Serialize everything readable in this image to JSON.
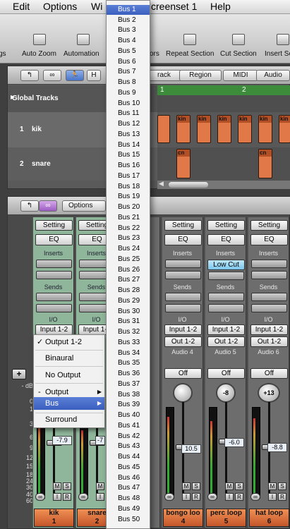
{
  "menubar": {
    "items": [
      "Edit",
      "Options",
      "Wi",
      "creenset 1",
      "Help"
    ]
  },
  "toolbar": {
    "buttons": [
      {
        "label": "gs",
        "icon": "partial-icon"
      },
      {
        "label": "Auto Zoom",
        "icon": "magnifier-icon"
      },
      {
        "label": "Automation",
        "icon": "automation-icon"
      },
      {
        "label": "ors",
        "icon": "partial-icon"
      },
      {
        "label": "Repeat Section",
        "icon": "repeat-icon"
      },
      {
        "label": "Cut Section",
        "icon": "scissors-icon"
      },
      {
        "label": "Insert Se",
        "icon": "insert-icon"
      }
    ]
  },
  "arrange": {
    "header_buttons": {
      "back": "↰",
      "link": "∞",
      "catch": "🏃",
      "h": "H"
    },
    "menus": [
      "rack",
      "Region",
      "MIDI",
      "Audio"
    ],
    "ruler": [
      "1",
      "2"
    ],
    "global_tracks": "Global Tracks",
    "tracks": [
      {
        "num": "1",
        "name": "kik",
        "region_label": "kin"
      },
      {
        "num": "2",
        "name": "snare",
        "region_label": "cn"
      }
    ]
  },
  "mixer": {
    "header": {
      "back": "↰",
      "link": "∞",
      "options": "Options"
    },
    "db_label": "- dB",
    "scale": [
      "0",
      "1",
      "3",
      "6",
      "9",
      "12",
      "15",
      "18",
      "24",
      "30",
      "40",
      "60"
    ],
    "strips": [
      {
        "setting": "Setting",
        "eq": "EQ",
        "inserts": "Inserts",
        "sends": "Sends",
        "io": "I/O",
        "input": "Input 1-2",
        "output": "",
        "audio": "",
        "off": "",
        "pan": "",
        "vol": "-7.9",
        "name": "kik",
        "num": "1",
        "selected": true,
        "m": "M",
        "s": "S",
        "i": "I",
        "r": "R"
      },
      {
        "setting": "Setting",
        "eq": "EQ",
        "inserts": "Inserts",
        "sends": "Sends",
        "io": "I/O",
        "input": "Input 1-2",
        "output": "",
        "audio": "",
        "off": "",
        "pan": "",
        "vol": "-7",
        "name": "snare",
        "num": "2",
        "selected": true,
        "m": "M",
        "s": "S",
        "i": "I",
        "r": "R"
      },
      {
        "setting": "",
        "eq": "",
        "inserts": "",
        "sends": "",
        "io": "",
        "input": "",
        "output": "",
        "audio": "",
        "off": "",
        "pan": "",
        "vol": "",
        "name": "",
        "num": "",
        "selected": false,
        "m": "M",
        "s": "S",
        "i": "I",
        "r": "R"
      },
      {
        "setting": "Setting",
        "eq": "EQ",
        "inserts": "Inserts",
        "sends": "Sends",
        "io": "I/O",
        "input": "Input 1-2",
        "output": "Out 1-2",
        "audio": "Audio 4",
        "off": "Off",
        "pan": "",
        "vol": "10.5",
        "name": "bongo loo",
        "num": "4",
        "selected": false,
        "m": "M",
        "s": "S",
        "i": "I",
        "r": "R"
      },
      {
        "setting": "Setting",
        "eq": "EQ",
        "inserts": "Inserts",
        "insert_plugin": "Low Cut",
        "sends": "Sends",
        "io": "I/O",
        "input": "Input 1-2",
        "output": "Out 1-2",
        "audio": "Audio 5",
        "off": "Off",
        "pan": "-8",
        "vol": "-6.0",
        "name": "perc loop",
        "num": "5",
        "selected": false,
        "m": "M",
        "s": "S",
        "i": "I",
        "r": "R"
      },
      {
        "setting": "Setting",
        "eq": "EQ",
        "inserts": "Inserts",
        "sends": "Sends",
        "io": "I/O",
        "input": "Input 1-2",
        "output": "Out 1-2",
        "audio": "Audio 6",
        "off": "Off",
        "pan": "+13",
        "vol": "-8.8",
        "name": "hat loop",
        "num": "6",
        "selected": false,
        "m": "M",
        "s": "S",
        "i": "I",
        "r": "R"
      }
    ]
  },
  "context_menu": {
    "items": [
      {
        "label": "Output 1-2",
        "check": "✓"
      },
      {
        "label": "Binaural"
      },
      {
        "label": "No Output"
      },
      {
        "label": "Output",
        "submenu": "▶"
      },
      {
        "label": "Bus",
        "submenu": "▶"
      },
      {
        "label": "Surround"
      }
    ],
    "dash": "-"
  },
  "bus_menu": {
    "items": [
      "Bus 1",
      "Bus 2",
      "Bus 3",
      "Bus 4",
      "Bus 5",
      "Bus 6",
      "Bus 7",
      "Bus 8",
      "Bus 9",
      "Bus 10",
      "Bus 11",
      "Bus 12",
      "Bus 13",
      "Bus 14",
      "Bus 15",
      "Bus 16",
      "Bus 17",
      "Bus 18",
      "Bus 19",
      "Bus 20",
      "Bus 21",
      "Bus 22",
      "Bus 23",
      "Bus 24",
      "Bus 25",
      "Bus 26",
      "Bus 27",
      "Bus 28",
      "Bus 29",
      "Bus 30",
      "Bus 31",
      "Bus 32",
      "Bus 33",
      "Bus 34",
      "Bus 35",
      "Bus 36",
      "Bus 37",
      "Bus 38",
      "Bus 39",
      "Bus 40",
      "Bus 41",
      "Bus 42",
      "Bus 43",
      "Bus 44",
      "Bus 45",
      "Bus 46",
      "Bus 47",
      "Bus 48",
      "Bus 49",
      "Bus 50"
    ],
    "highlighted": "Bus 1"
  },
  "colors": {
    "region": "#e07848",
    "selected_strip": "#8fb69a",
    "menu_highlight": "#3a5fbf",
    "low_cut": "#8fd0f0"
  }
}
